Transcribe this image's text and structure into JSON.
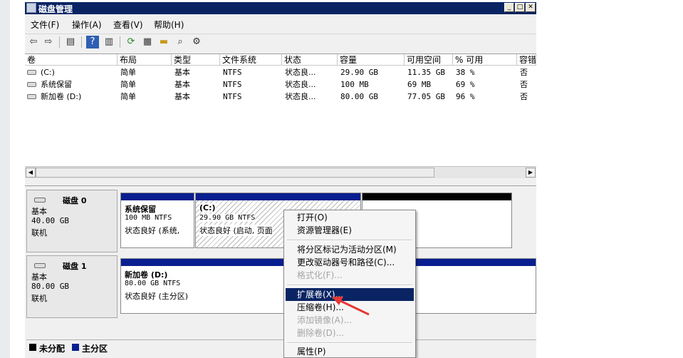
{
  "window": {
    "title": "磁盘管理"
  },
  "menu": [
    "文件(F)",
    "操作(A)",
    "查看(V)",
    "帮助(H)"
  ],
  "list": {
    "columns": [
      "卷",
      "布局",
      "类型",
      "文件系统",
      "状态",
      "容量",
      "可用空间",
      "% 可用",
      "容错"
    ],
    "rows": [
      [
        "(C:)",
        "简单",
        "基本",
        "NTFS",
        "状态良...",
        "29.90 GB",
        "11.35 GB",
        "38 %",
        "否"
      ],
      [
        "系统保留",
        "简单",
        "基本",
        "NTFS",
        "状态良...",
        "100 MB",
        "69 MB",
        "69 %",
        "否"
      ],
      [
        "新加卷 (D:)",
        "简单",
        "基本",
        "NTFS",
        "状态良...",
        "80.00 GB",
        "77.05 GB",
        "96 %",
        "否"
      ]
    ]
  },
  "disks": [
    {
      "name": "磁盘 0",
      "type": "基本",
      "size": "40.00 GB",
      "status": "联机",
      "partitions": [
        {
          "name": "系统保留",
          "size_fs": "100 MB NTFS",
          "status": "状态良好 (系统,"
        },
        {
          "name": "(C:)",
          "size_fs": "29.90 GB NTFS",
          "status": "状态良好 (启动, 页面"
        }
      ]
    },
    {
      "name": "磁盘 1",
      "type": "基本",
      "size": "80.00 GB",
      "status": "联机",
      "partitions": [
        {
          "name": "新加卷 (D:)",
          "size_fs": "80.00 GB NTFS",
          "status": "状态良好 (主分区)"
        }
      ]
    }
  ],
  "legend": [
    {
      "label": "未分配",
      "color": "#000000"
    },
    {
      "label": "主分区",
      "color": "#0a1f8f"
    }
  ],
  "context_menu": {
    "items": [
      {
        "label": "打开(O)",
        "enabled": true
      },
      {
        "label": "资源管理器(E)",
        "enabled": true
      },
      {
        "label": "将分区标记为活动分区(M)",
        "enabled": true
      },
      {
        "label": "更改驱动器号和路径(C)...",
        "enabled": true
      },
      {
        "label": "格式化(F)...",
        "enabled": false
      },
      {
        "label": "扩展卷(X)...",
        "enabled": true,
        "highlighted": true
      },
      {
        "label": "压缩卷(H)...",
        "enabled": true
      },
      {
        "label": "添加镜像(A)...",
        "enabled": false
      },
      {
        "label": "删除卷(D)...",
        "enabled": false
      },
      {
        "label": "属性(P)",
        "enabled": true
      }
    ]
  },
  "colors": {
    "titlebar": "#0a2463",
    "primary_partition": "#0a1f8f",
    "annotation_arrow": "#e53935"
  }
}
